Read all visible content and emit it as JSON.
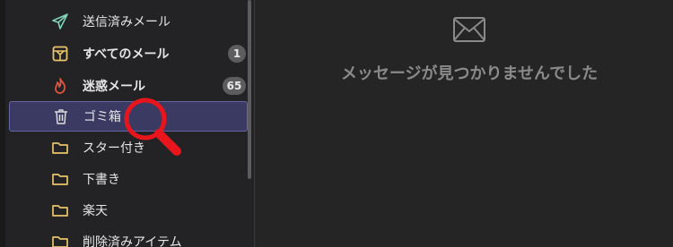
{
  "sidebar": {
    "items": [
      {
        "label": "送信済みメール",
        "icon": "send-icon"
      },
      {
        "label": "すべてのメール",
        "icon": "archive-icon",
        "badge": "1"
      },
      {
        "label": "迷惑メール",
        "icon": "flame-icon",
        "badge": "65"
      },
      {
        "label": "ゴミ箱",
        "icon": "trash-icon",
        "selected": true
      },
      {
        "label": "スター付き",
        "icon": "folder-icon"
      },
      {
        "label": "下書き",
        "icon": "folder-icon"
      },
      {
        "label": "楽天",
        "icon": "folder-icon"
      },
      {
        "label": "削除済みアイテム",
        "icon": "folder-icon"
      }
    ]
  },
  "main": {
    "empty_message": "メッセージが見つかりませんでした",
    "empty_icon": "envelope-icon"
  },
  "overlay": {
    "icon": "magnifier-icon"
  },
  "colors": {
    "selected_bg": "#3b3a63",
    "selected_border": "#6764a6",
    "folder": "#e9c46a",
    "send": "#7fd3b4",
    "flame": "#e5533d",
    "magnifier": "#e8151c"
  }
}
